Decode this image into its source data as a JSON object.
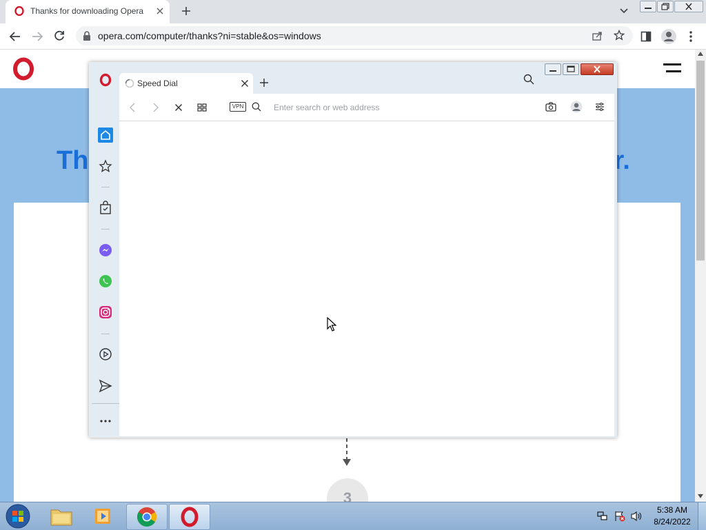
{
  "browser": {
    "tab_title": "Thanks for downloading Opera",
    "new_tab_symbol": "+",
    "url": "opera.com/computer/thanks?ni=stable&os=windows"
  },
  "page": {
    "hero_left": "Th",
    "hero_right": "ır.",
    "step_number": "3"
  },
  "opera_window": {
    "tab_title": "Speed Dial",
    "new_tab_symbol": "+",
    "vpn_badge": "VPN",
    "address_placeholder": "Enter search or web address",
    "sidebar_items": [
      "home-icon",
      "star-icon",
      "shopping-bag-icon",
      "messenger-icon",
      "whatsapp-icon",
      "instagram-icon",
      "player-icon",
      "send-icon",
      "more-icon"
    ]
  },
  "taskbar": {
    "time": "5:38 AM",
    "date": "8/24/2022"
  },
  "colors": {
    "opera_red": "#d21b2c",
    "page_blue": "#8fbce6",
    "hero_blue": "#1a6ed8",
    "active_sidebar": "#1e88e5"
  }
}
